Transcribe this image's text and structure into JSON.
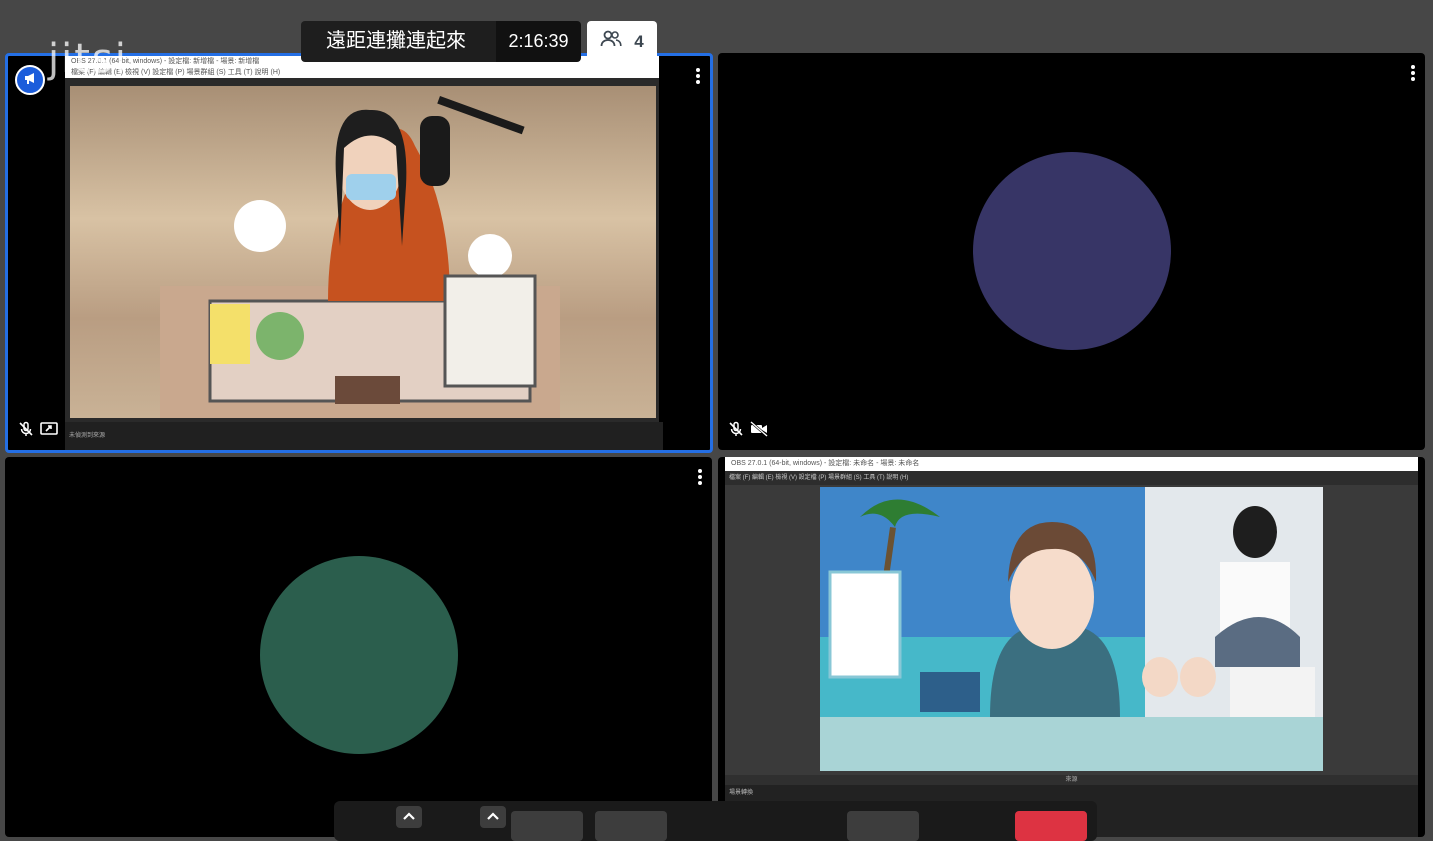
{
  "app": {
    "logo_text": "jitsi",
    "meeting_title": "遠距連攤連起來",
    "timer": "2:16:39",
    "participant_count": "4"
  },
  "tiles": [
    {
      "id": "tile-1",
      "type": "screen-share",
      "active_speaker": true,
      "mic_muted": true,
      "screen_sharing": true,
      "share_window_title": "OBS 27.0.1 (64-bit, windows) - 設定檔: 新增檔 - 場景: 新增檔",
      "share_menu": "檔案 (F)   編輯 (E)   檢視 (V)   設定檔 (P)   場景群組 (S)   工具 (T)   說明 (H)",
      "share_status": "未偵測到來源"
    },
    {
      "id": "tile-2",
      "type": "avatar",
      "avatar_color": "#373566",
      "mic_muted": true,
      "video_muted": true
    },
    {
      "id": "tile-3",
      "type": "avatar",
      "avatar_color": "#2b5e4d"
    },
    {
      "id": "tile-4",
      "type": "screen-share",
      "share_window_title": "OBS 27.0.1 (64-bit, windows) - 設定檔: 未命名 - 場景: 未命名",
      "share_menu": "檔案 (F)   編輯 (E)   檢視 (V)   設定檔 (P)   場景群組 (S)   工具 (T)   說明 (H)",
      "share_lower_header": "來源",
      "share_lower_item": "場景轉換"
    }
  ],
  "colors": {
    "background": "#474747",
    "active_border": "#246fe5",
    "hangup": "#dd3342",
    "moderator_badge": "#1c5ddb"
  }
}
